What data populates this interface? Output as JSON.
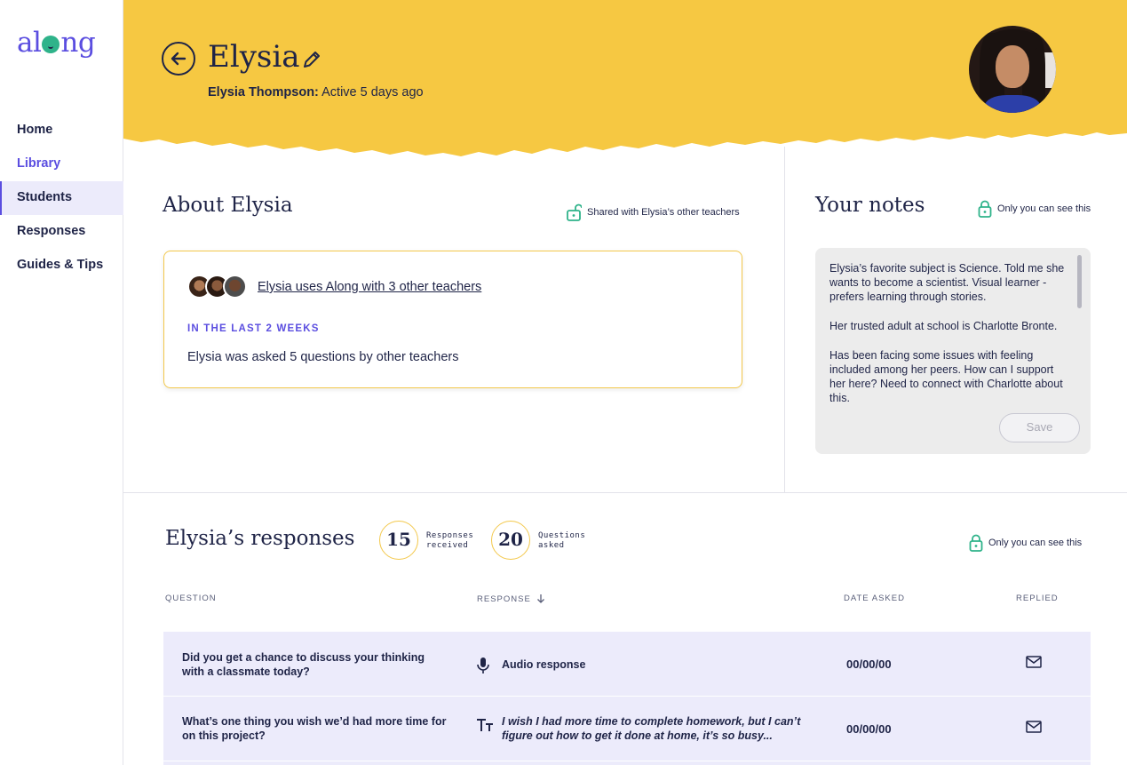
{
  "app": {
    "logo_text": "along",
    "brand_color": "#5b4ee0",
    "header_color": "#f6c842"
  },
  "sidebar": {
    "items": [
      {
        "label": "Home"
      },
      {
        "label": "Library"
      },
      {
        "label": "Students"
      },
      {
        "label": "Responses"
      },
      {
        "label": "Guides & Tips"
      }
    ],
    "active": "Students"
  },
  "header": {
    "name": "Elysia",
    "full_name": "Elysia Thompson:",
    "status": "Active 5 days ago",
    "back_icon": "arrow-left-circle-icon",
    "edit_icon": "pencil-icon"
  },
  "about": {
    "title": "About Elysia",
    "shared_note": "Shared with Elysia’s other teachers",
    "teachers_link": "Elysia uses Along with 3 other teachers",
    "kicker": "IN THE LAST 2 WEEKS",
    "summary": "Elysia was asked 5 questions by other teachers"
  },
  "notes": {
    "title": "Your notes",
    "privacy": "Only you can see this",
    "paragraphs": [
      "Elysia’s favorite subject is Science. Told me she wants to become a scientist. Visual learner - prefers learning through stories.",
      "Her trusted adult at school is Charlotte Bronte.",
      "Has been facing some issues with feeling included among her peers. How can I support her here? Need to connect with Charlotte about this."
    ],
    "save_label": "Save"
  },
  "responses": {
    "title": "Elysia’s responses",
    "received_count": "15",
    "received_label_1": "Responses",
    "received_label_2": "received",
    "asked_count": "20",
    "asked_label_1": "Questions",
    "asked_label_2": "asked",
    "privacy": "Only you can see this",
    "columns": {
      "question": "QUESTION",
      "response": "RESPONSE",
      "date": "DATE ASKED",
      "replied": "REPLIED"
    },
    "rows": [
      {
        "question": "Did you get a chance to discuss your thinking with a classmate today?",
        "response_type": "audio",
        "response_icon": "microphone-icon",
        "response": "Audio response",
        "date": "00/00/00",
        "replied_icon": "mail-icon"
      },
      {
        "question": "What’s one thing you wish we’d had more time for on this project?",
        "response_type": "text",
        "response_icon": "text-icon",
        "response": "I wish I had more time to complete homework, but I can’t figure out how to get it done at home, it’s so busy...",
        "date": "00/00/00",
        "replied_icon": "mail-icon"
      }
    ]
  }
}
